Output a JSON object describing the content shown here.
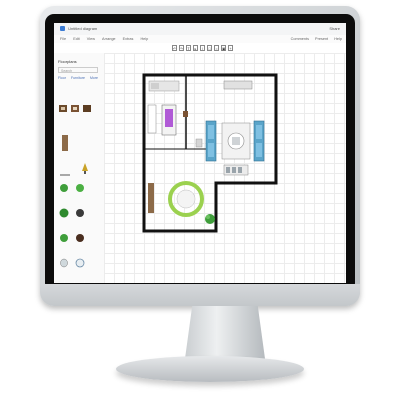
{
  "app": {
    "document_title": "Untitled diagram",
    "share_label": "Share"
  },
  "menu": {
    "items": [
      "File",
      "Edit",
      "View",
      "Arrange",
      "Extras",
      "Help"
    ],
    "right_items": [
      "Comments",
      "Present",
      "Help"
    ]
  },
  "left_panel": {
    "title": "Floorplans",
    "search_placeholder": "Search",
    "tabs": [
      "Floor",
      "Furniture",
      "More"
    ]
  },
  "colors": {
    "wall": "#111111",
    "sofa": "#5aa4c9",
    "rug_ring": "#9bd14f",
    "bed_accent": "#b05ad6",
    "plant": "#3f9e3b"
  },
  "shapes": [
    "table-icon",
    "chair-icon",
    "lamp-icon",
    "plant-icon",
    "rug-icon",
    "toilet-icon",
    "clock-icon"
  ]
}
